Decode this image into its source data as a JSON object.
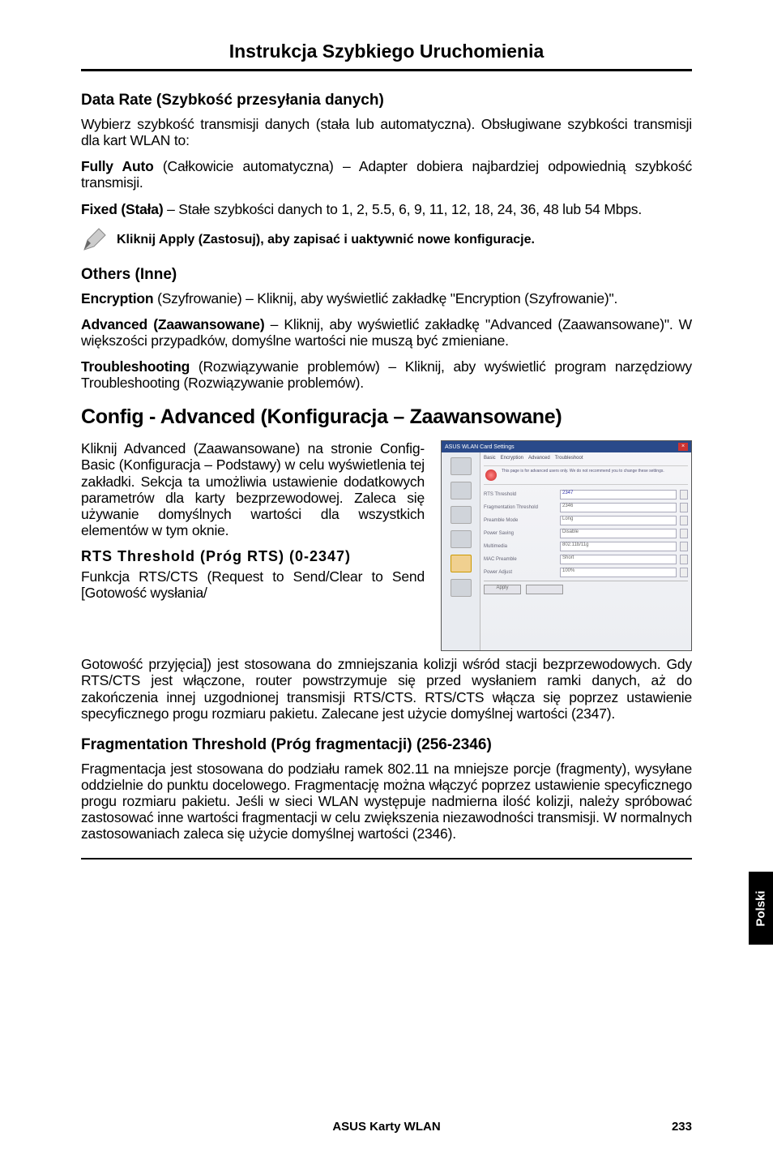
{
  "header": {
    "title": "Instrukcja Szybkiego Uruchomienia"
  },
  "dataRate": {
    "heading": "Data Rate (Szybkość przesyłania danych)",
    "intro": "Wybierz szybkość transmisji danych (stała lub automatyczna). Obsługiwane szybkości transmisji dla kart WLAN to:",
    "fullyAuto_label": "Fully Auto",
    "fullyAuto_text": " (Całkowicie automatyczna) – Adapter dobiera najbardziej odpowiednią szybkość transmisji.",
    "fixed_label": "Fixed (Stała)",
    "fixed_text": " – Stałe szybkości danych to 1, 2, 5.5, 6, 9, 11, 12, 18, 24, 36, 48 lub 54 Mbps."
  },
  "note": {
    "text": "Kliknij Apply (Zastosuj), aby zapisać i uaktywnić nowe konfiguracje."
  },
  "others": {
    "heading": "Others (Inne)",
    "encryption_label": "Encryption",
    "encryption_text": " (Szyfrowanie) – Kliknij, aby wyświetlić zakładkę \"Encryption (Szyfrowanie)\".",
    "advanced_label": "Advanced (Zaawansowane)",
    "advanced_text": " – Kliknij, aby wyświetlić zakładkę \"Advanced (Zaawansowane)\". W większości przypadków, domyślne wartości nie muszą być zmieniane.",
    "troubleshooting_label": "Troubleshooting",
    "troubleshooting_text": " (Rozwiązywanie problemów) – Kliknij, aby wyświetlić program narzędziowy Troubleshooting (Rozwiązywanie problemów)."
  },
  "configAdvanced": {
    "heading": "Config - Advanced (Konfiguracja – Zaawansowane)",
    "intro": "Kliknij Advanced (Zaawansowane) na stronie Config-Basic (Konfiguracja – Podstawy) w celu wyświetlenia tej zakładki. Sekcja ta umożliwia ustawienie dodatkowych parametrów dla karty bezprzewodowej. Zaleca się używanie domyślnych wartości dla wszystkich elementów w tym oknie."
  },
  "rts": {
    "heading": "RTS Threshold (Próg RTS) (0-2347)",
    "body1": "Funkcja RTS/CTS (Request to Send/Clear to Send [Gotowość wysłania/",
    "body2": "Gotowość przyjęcia]) jest stosowana do zmniejszania kolizji wśród stacji bezprzewodowych. Gdy RTS/CTS jest włączone, router powstrzymuje się przed wysłaniem ramki danych, aż do zakończenia innej uzgodnionej transmisji RTS/CTS. RTS/CTS włącza się poprzez ustawienie specyficznego progu rozmiaru pakietu. Zalecane jest użycie domyślnej wartości (2347)."
  },
  "fragmentation": {
    "heading": "Fragmentation Threshold (Próg fragmentacji) (256-2346)",
    "body": "Fragmentacja jest stosowana do podziału ramek 802.11 na mniejsze porcje (fragmenty), wysyłane oddzielnie do punktu docelowego. Fragmentację można włączyć poprzez ustawienie specyficznego progu rozmiaru pakietu. Jeśli w sieci WLAN występuje nadmierna ilość kolizji, należy spróbować zastosować inne wartości fragmentacji w celu zwiększenia niezawodności transmisji. W normalnych zastosowaniach zaleca się użycie domyślnej wartości (2346)."
  },
  "screenshot": {
    "windowTitle": "ASUS WLAN Card Settings",
    "tabs": {
      "basic": "Basic",
      "encryption": "Encryption",
      "advanced": "Advanced",
      "trouble": "Troubleshoot"
    },
    "info": "This page is for advanced users only. We do not recommend you to change these settings.",
    "fields": {
      "rts": "RTS Threshold",
      "frag": "Fragmentation Threshold",
      "preamble": "Preamble Mode",
      "power": "Power Saving",
      "mode": "Multimedia",
      "mac": "MAC Preamble",
      "adapter": "Power Adjust"
    },
    "values": {
      "rts": "2347",
      "frag": "2346",
      "preamble": "Long",
      "power": "Disable",
      "mode": "802.11b/11g",
      "mac": "Short",
      "adapter": "100%"
    },
    "apply": "Apply"
  },
  "sideTab": "Polski",
  "footer": {
    "text": "ASUS Karty WLAN",
    "page": "233"
  }
}
